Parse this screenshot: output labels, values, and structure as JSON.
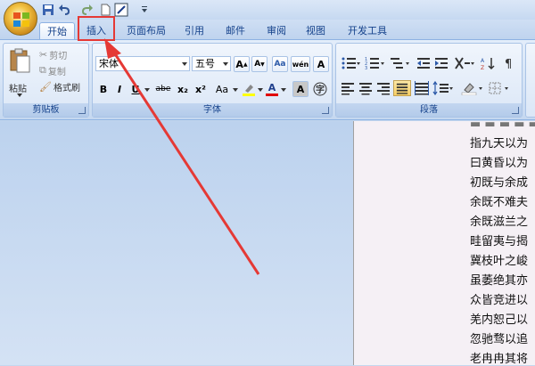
{
  "tabs": [
    "开始",
    "插入",
    "页面布局",
    "引用",
    "邮件",
    "审阅",
    "视图",
    "开发工具"
  ],
  "clipboard": {
    "paste": "粘贴",
    "cut": "剪切",
    "copy": "复制",
    "format_painter": "格式刷",
    "label": "剪贴板"
  },
  "font": {
    "name": "宋体",
    "size": "五号",
    "label": "字体",
    "buttons": [
      "B",
      "I",
      "U",
      "abe",
      "x₂",
      "x²",
      "Aa",
      "A"
    ]
  },
  "paragraph": {
    "label": "段落"
  },
  "document_lines": [
    "指九天以为",
    "曰黄昏以为",
    "初既与余成",
    "余既不难夫",
    "余既滋兰之",
    "畦留夷与揭",
    "冀枝叶之峻",
    "虽萎绝其亦",
    "众皆竞进以",
    "羌内恕己以",
    "忽驰骛以追",
    "老冉冉其将"
  ],
  "colors": {
    "highlight_box": "#e53935",
    "ribbon_text": "#15428b"
  }
}
